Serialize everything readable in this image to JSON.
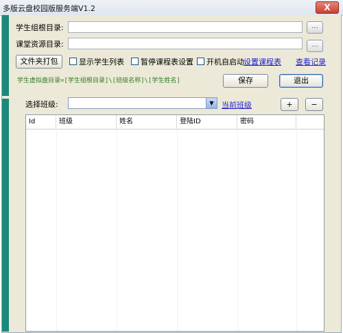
{
  "window": {
    "title": "多版云盘校园版服务端V1.2",
    "close_label": "X"
  },
  "form": {
    "student_root_label": "学生组根目录:",
    "student_root_value": "",
    "course_res_label": "课堂资源目录:",
    "course_res_value": "",
    "browse_label": "..."
  },
  "options": {
    "pack_button": "文件夹打包",
    "show_list": "显示学生列表",
    "pause_schedule": "暂停课程表设置",
    "autostart": "开机自启动",
    "set_schedule_link": "设置课程表",
    "view_log_link": "查看记录",
    "hint": "学生虚拟盘目录=[学生组根目录]\\[班级名称]\\[学生姓名]",
    "save_button": "保存",
    "exit_button": "退出"
  },
  "class": {
    "label": "选择班级:",
    "selected": "",
    "current_link": "当前班级",
    "add_button": "+",
    "remove_button": "−"
  },
  "table": {
    "columns": [
      "Id",
      "班级",
      "姓名",
      "登陆ID",
      "密码"
    ],
    "rows": []
  }
}
